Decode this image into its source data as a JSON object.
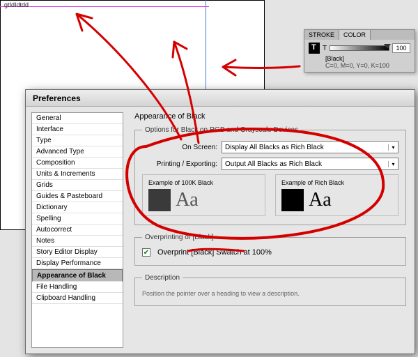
{
  "canvas_text": "gtIdIdtdd",
  "color_panel": {
    "tabs": {
      "stroke": "STROKE",
      "color": "COLOR"
    },
    "tint_label": "T",
    "tint_value": "100",
    "swatch_name": "[Black]",
    "swatch_info": "C=0, M=0, Y=0, K=100"
  },
  "prefs": {
    "title": "Preferences",
    "sidebar": [
      "General",
      "Interface",
      "Type",
      "Advanced Type",
      "Composition",
      "Units & Increments",
      "Grids",
      "Guides & Pasteboard",
      "Dictionary",
      "Spelling",
      "Autocorrect",
      "Notes",
      "Story Editor Display",
      "Display Performance",
      "Appearance of Black",
      "File Handling",
      "Clipboard Handling"
    ],
    "selected_index": 14,
    "section_title": "Appearance of Black",
    "options_legend": "Options for Black on RGB and Grayscale Devices",
    "onscreen_label": "On Screen:",
    "onscreen_value": "Display All Blacks as Rich Black",
    "print_label": "Printing / Exporting:",
    "print_value": "Output All Blacks as Rich Black",
    "ex100_label": "Example of 100K Black",
    "exrich_label": "Example of Rich Black",
    "ex_aa": "Aa",
    "overprint_legend": "Overprinting of [Black]",
    "overprint_check": "Overprint [Black] Swatch at 100%",
    "desc_legend": "Description",
    "desc_text": "Position the pointer over a heading to view a description."
  }
}
